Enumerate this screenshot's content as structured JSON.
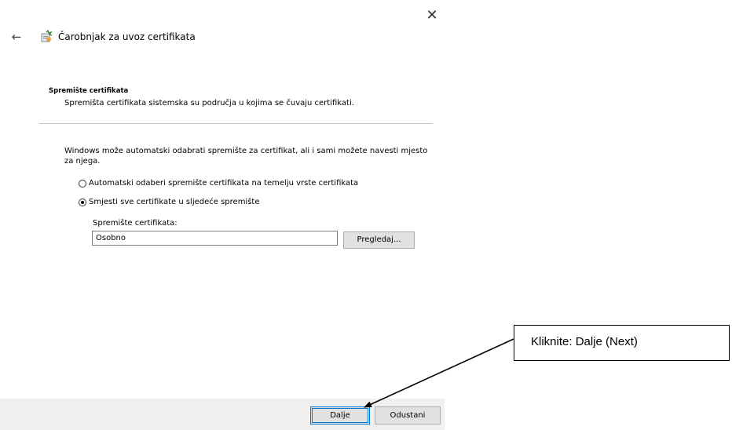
{
  "window": {
    "title": "Čarobnjak za uvoz certifikata",
    "close_glyph": "✕",
    "back_glyph": "←",
    "icons": [
      "back-arrow-icon",
      "certificate-wizard-icon",
      "close-icon"
    ]
  },
  "section": {
    "heading": "Spremište certifikata",
    "description": "Spremišta certifikata sistemska su područja u kojima se čuvaju certifikati."
  },
  "body": {
    "intro": "Windows može automatski odabrati spremište za certifikat, ali i sami možete navesti mjesto za njega.",
    "options": [
      {
        "label": "Automatski odaberi spremište certifikata na temelju vrste certifikata",
        "selected": false
      },
      {
        "label": "Smjesti sve certifikate u sljedeće spremište",
        "selected": true
      }
    ],
    "store_label": "Spremište certifikata:",
    "store_value": "Osobno",
    "browse_label": "Pregledaj..."
  },
  "footer": {
    "next_label": "Dalje",
    "cancel_label": "Odustani"
  },
  "annotation": {
    "text": "Kliknite: Dalje (Next)"
  },
  "colors": {
    "footer_bg": "#f0f0f0",
    "button_bg": "#e1e1e1",
    "default_button_border": "#0078d7"
  }
}
